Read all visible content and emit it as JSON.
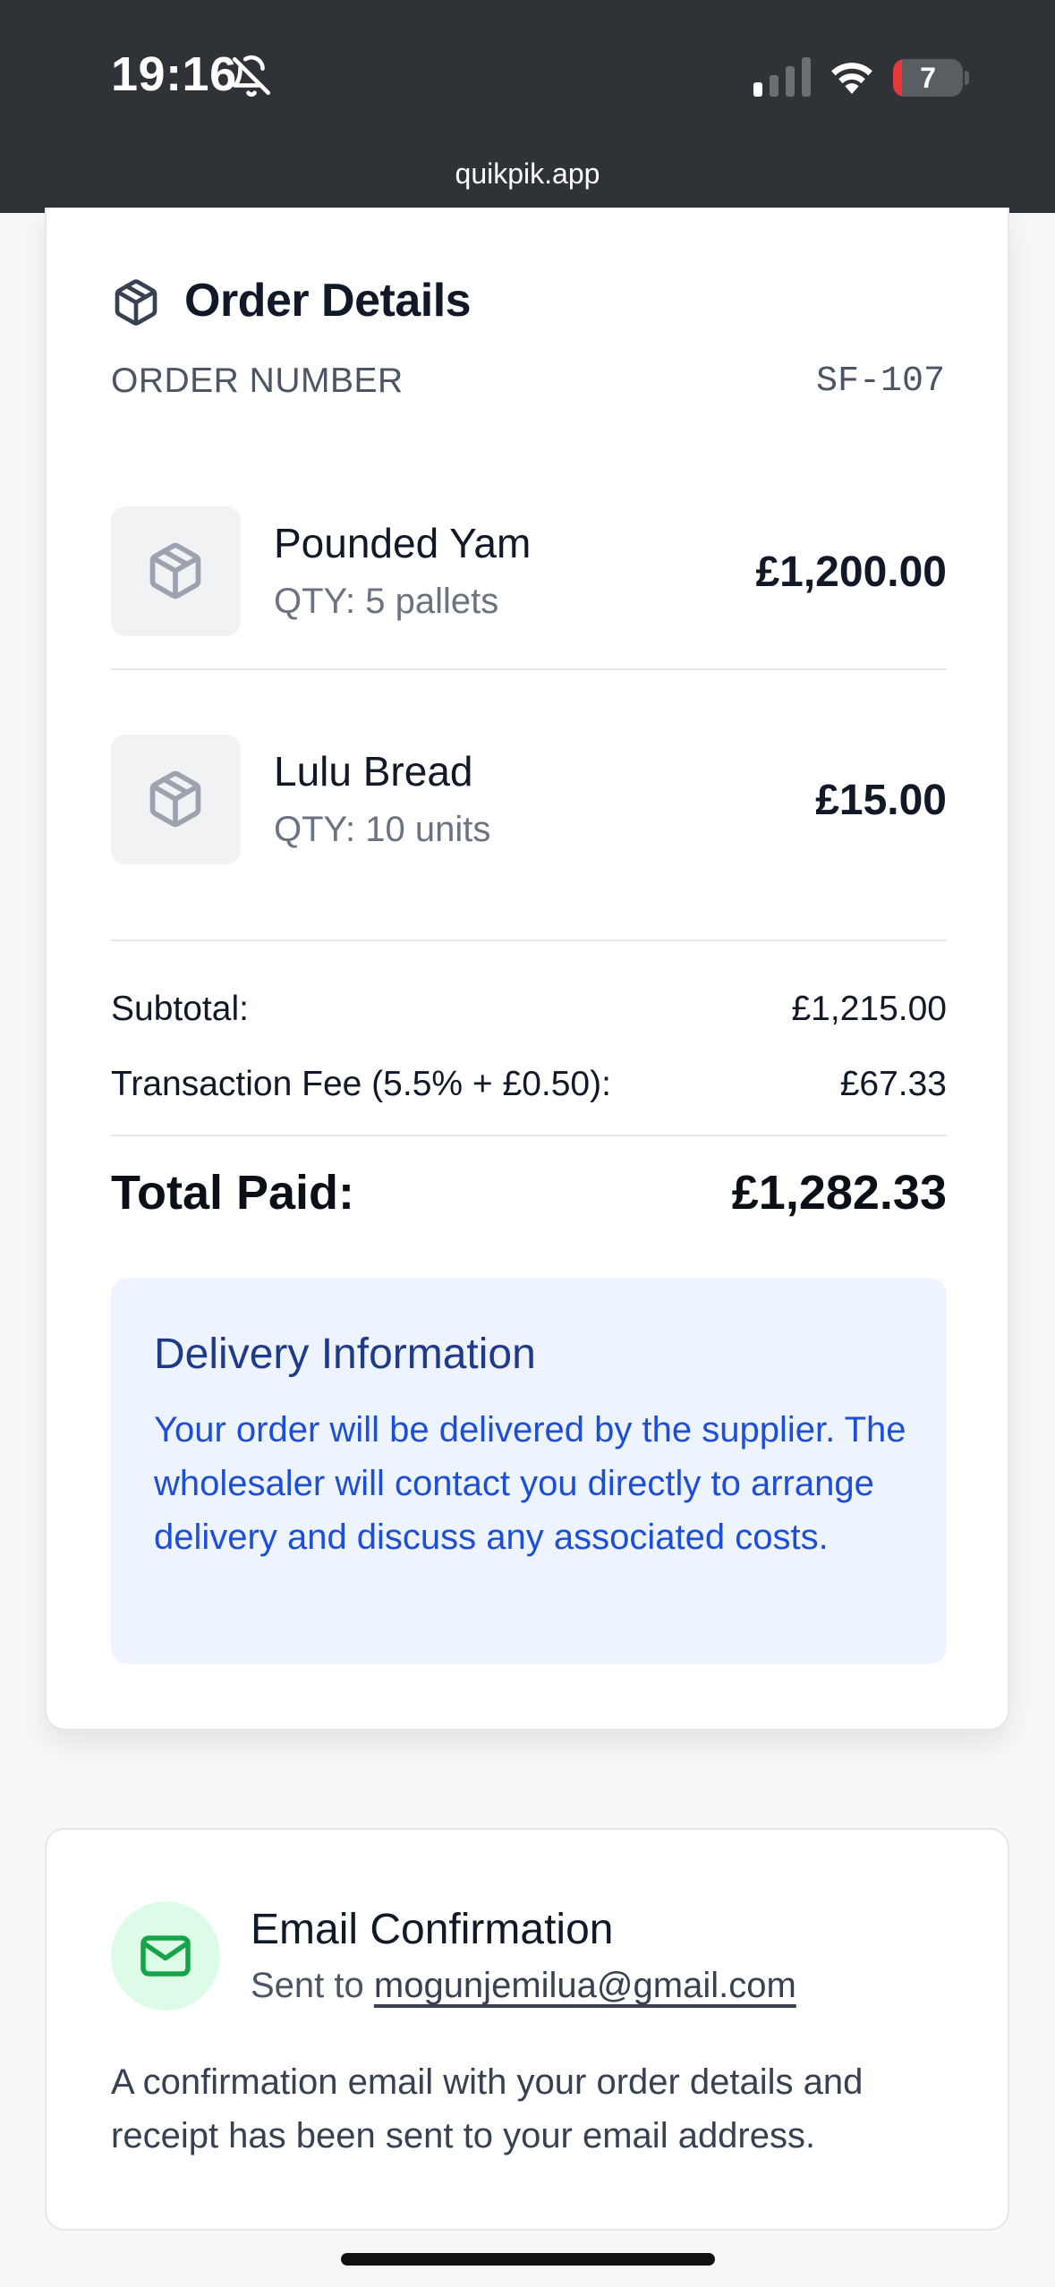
{
  "status_bar": {
    "time": "19:16",
    "battery_level": "7",
    "battery_fraction": 0.07,
    "signal_bars_active": 1,
    "signal_bars_total": 4,
    "icons": [
      "bell-slash-icon",
      "cellular-signal-icon",
      "wifi-icon",
      "battery-icon"
    ]
  },
  "browser": {
    "url": "quikpik.app"
  },
  "order": {
    "title": "Order Details",
    "title_icon": "package-icon",
    "number_label": "ORDER NUMBER",
    "number_value": "SF-107",
    "items": [
      {
        "name": "Pounded Yam",
        "qty": "QTY: 5 pallets",
        "price": "£1,200.00",
        "icon": "package-icon"
      },
      {
        "name": "Lulu Bread",
        "qty": "QTY: 10 units",
        "price": "£15.00",
        "icon": "package-icon"
      }
    ],
    "subtotal_label": "Subtotal:",
    "subtotal_value": "£1,215.00",
    "fee_label": "Transaction Fee (5.5% + £0.50):",
    "fee_value": "£67.33",
    "total_label": "Total Paid:",
    "total_value": "£1,282.33"
  },
  "delivery": {
    "title": "Delivery Information",
    "body": "Your order will be delivered by the supplier. The wholesaler will contact you directly to arrange delivery and discuss any associated costs."
  },
  "email": {
    "icon": "mail-icon",
    "title": "Email Confirmation",
    "sent_prefix": "Sent to ",
    "address": "mogunjemilua@gmail.com",
    "body": "A confirmation email with your order details and receipt has been sent to your email address."
  },
  "colors": {
    "status_bar_bg": "#2f3236",
    "page_bg": "#f6f7f9",
    "delivery_bg": "#eef4ff",
    "delivery_text": "#1d4ed8",
    "mail_circle_bg": "#dcfce7",
    "mail_icon": "#16a34a",
    "battery_low": "#e5383b"
  }
}
